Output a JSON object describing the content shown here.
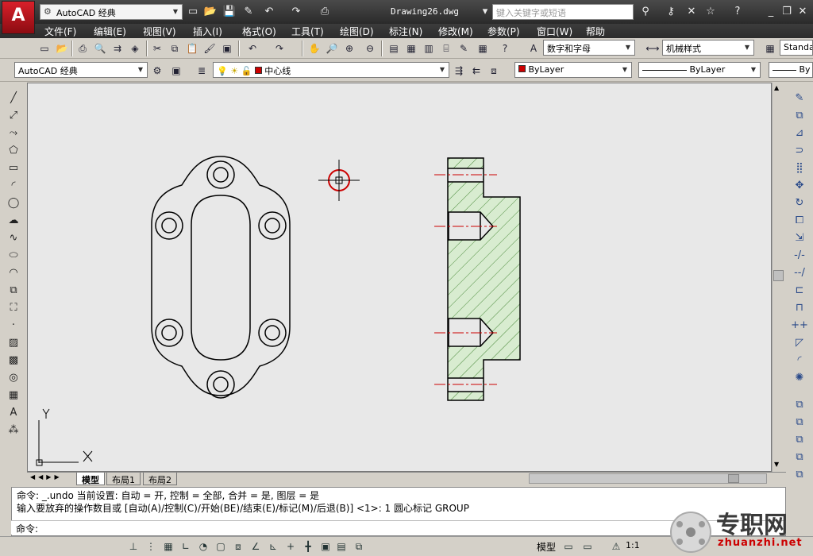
{
  "app": {
    "logo_letter": "A",
    "workspace": "AutoCAD 经典",
    "document_title": "Drawing26.dwg",
    "search_placeholder": "键入关键字或短语"
  },
  "menu": [
    "文件(F)",
    "编辑(E)",
    "视图(V)",
    "插入(I)",
    "格式(O)",
    "工具(T)",
    "绘图(D)",
    "标注(N)",
    "修改(M)",
    "参数(P)",
    "窗口(W)",
    "帮助"
  ],
  "toolbar2": {
    "text_style": "数字和字母",
    "dim_style": "机械样式",
    "table_style": "Standa"
  },
  "toolbar3": {
    "workspace": "AutoCAD 经典",
    "layer": "中心线",
    "color": "ByLayer",
    "linetype": "ByLayer",
    "lineweight": "By"
  },
  "colors": {
    "accent": "#cc0000",
    "hatch": "#d8ecd0",
    "canvas": "#e8e8e8"
  },
  "ucs": {
    "x_label": "X",
    "y_label": "Y"
  },
  "tabs": [
    "模型",
    "布局1",
    "布局2"
  ],
  "command": {
    "line1": "命令: _.undo 当前设置: 自动 = 开, 控制 = 全部, 合并 = 是, 图层 = 是",
    "line2": "输入要放弃的操作数目或 [自动(A)/控制(C)/开始(BE)/结束(E)/标记(M)/后退(B)] <1>: 1 圆心标记 GROUP",
    "prompt": "命令:"
  },
  "status": {
    "model": "模型",
    "scale": "1:1"
  },
  "watermark": {
    "cn": "专职网",
    "en": "zhuanzhi.net"
  }
}
